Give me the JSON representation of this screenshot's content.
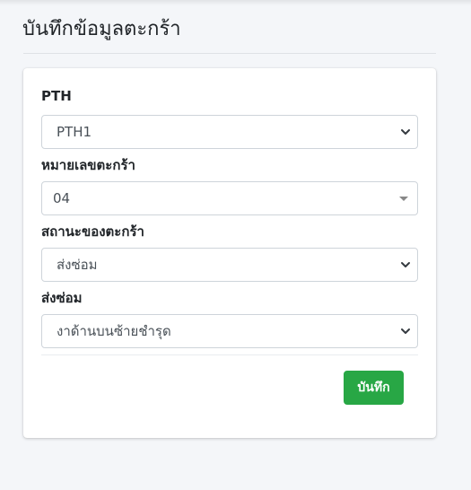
{
  "page": {
    "title": "บันทึกข้อมูลตะกร้า"
  },
  "form": {
    "fields": [
      {
        "label": "PTH",
        "value": "PTH1",
        "control": "select"
      },
      {
        "label": "หมายเลขตะกร้า",
        "value": "04",
        "control": "select2"
      },
      {
        "label": "สถานะของตะกร้า",
        "value": "ส่งซ่อม",
        "control": "select"
      },
      {
        "label": "ส่งซ่อม",
        "value": "งาด้านบนซ้ายชำรุด",
        "control": "select"
      }
    ],
    "save_label": "บันทึก"
  },
  "colors": {
    "primary_success": "#28a745",
    "background": "#f4f6f9",
    "card": "#ffffff"
  },
  "icons": {
    "select_arrow": "chevron-down-icon",
    "select2_arrow": "caret-down-icon"
  }
}
